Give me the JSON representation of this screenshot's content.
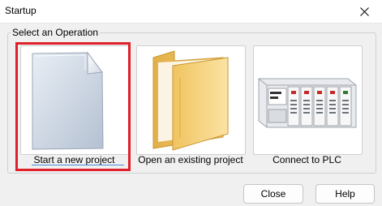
{
  "window": {
    "title": "Startup"
  },
  "group": {
    "label": "Select an Operation"
  },
  "operations": [
    {
      "label": "Start a new project",
      "icon": "new-document-icon",
      "selected": true
    },
    {
      "label": "Open an existing project",
      "icon": "folder-icon",
      "selected": false
    },
    {
      "label": "Connect to PLC",
      "icon": "plc-hardware-icon",
      "selected": false
    }
  ],
  "buttons": {
    "close": "Close",
    "help": "Help"
  },
  "colors": {
    "highlight": "#e0202a",
    "folder": "#f2c86a",
    "background": "#f0f0f0"
  }
}
